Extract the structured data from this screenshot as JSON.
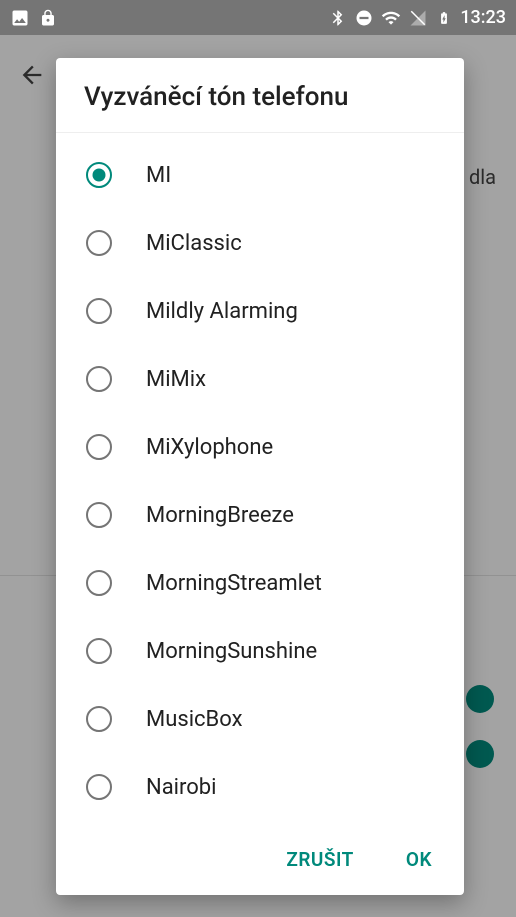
{
  "status": {
    "time": "13:23"
  },
  "background": {
    "peek_text": "dla"
  },
  "dialog": {
    "title": "Vyzváněcí tón telefonu",
    "selected_index": 0,
    "ringtones": [
      "MI",
      "MiClassic",
      "Mildly Alarming",
      "MiMix",
      "MiXylophone",
      "MorningBreeze",
      "MorningStreamlet",
      "MorningSunshine",
      "MusicBox",
      "Nairobi"
    ],
    "cancel_label": "ZRUŠIT",
    "ok_label": "OK"
  },
  "colors": {
    "accent": "#00897b"
  }
}
